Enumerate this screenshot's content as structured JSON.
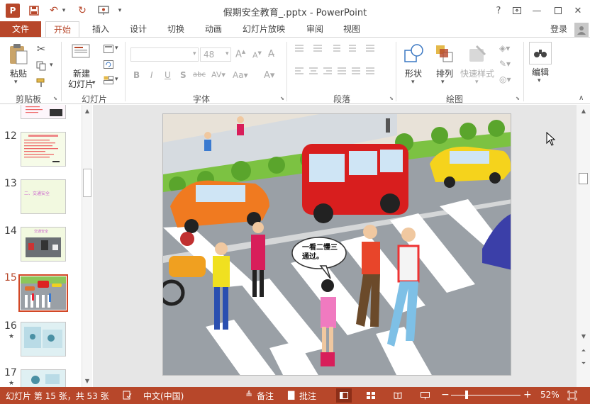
{
  "app": {
    "window_title": "假期安全教育_.pptx - PowerPoint",
    "logo_letter": "P",
    "help": "?",
    "signin": "登录"
  },
  "tabs": {
    "file": "文件",
    "home": "开始",
    "insert": "插入",
    "design": "设计",
    "transitions": "切换",
    "animations": "动画",
    "slideshow": "幻灯片放映",
    "review": "审阅",
    "view": "视图"
  },
  "ribbon": {
    "clipboard": {
      "paste": "粘贴",
      "label": "剪贴板"
    },
    "slides": {
      "new_slide_line1": "新建",
      "new_slide_line2": "幻灯片",
      "label": "幻灯片"
    },
    "font": {
      "size": "48",
      "label": "字体"
    },
    "paragraph": {
      "label": "段落"
    },
    "drawing": {
      "shapes": "形状",
      "arrange": "排列",
      "quick_styles": "快速样式",
      "label": "绘图"
    },
    "editing": {
      "edit": "编辑"
    }
  },
  "slides": [
    {
      "num": "12",
      "star": ""
    },
    {
      "num": "13",
      "star": "",
      "text": "二、交通安全"
    },
    {
      "num": "14",
      "star": "",
      "text": "交通安全"
    },
    {
      "num": "15",
      "star": "",
      "selected": true
    },
    {
      "num": "16",
      "star": "★"
    },
    {
      "num": "17",
      "star": "★"
    }
  ],
  "slide_content": {
    "speech": "一看二慢三通过。"
  },
  "status": {
    "slide_info": "幻灯片 第 15 张，共 53 张",
    "language": "中文(中国)",
    "notes": "备注",
    "comments": "批注",
    "zoom": "52%"
  },
  "colors": {
    "accent": "#b7472a",
    "road": "#9aa0a6",
    "grass": "#7cc242"
  }
}
